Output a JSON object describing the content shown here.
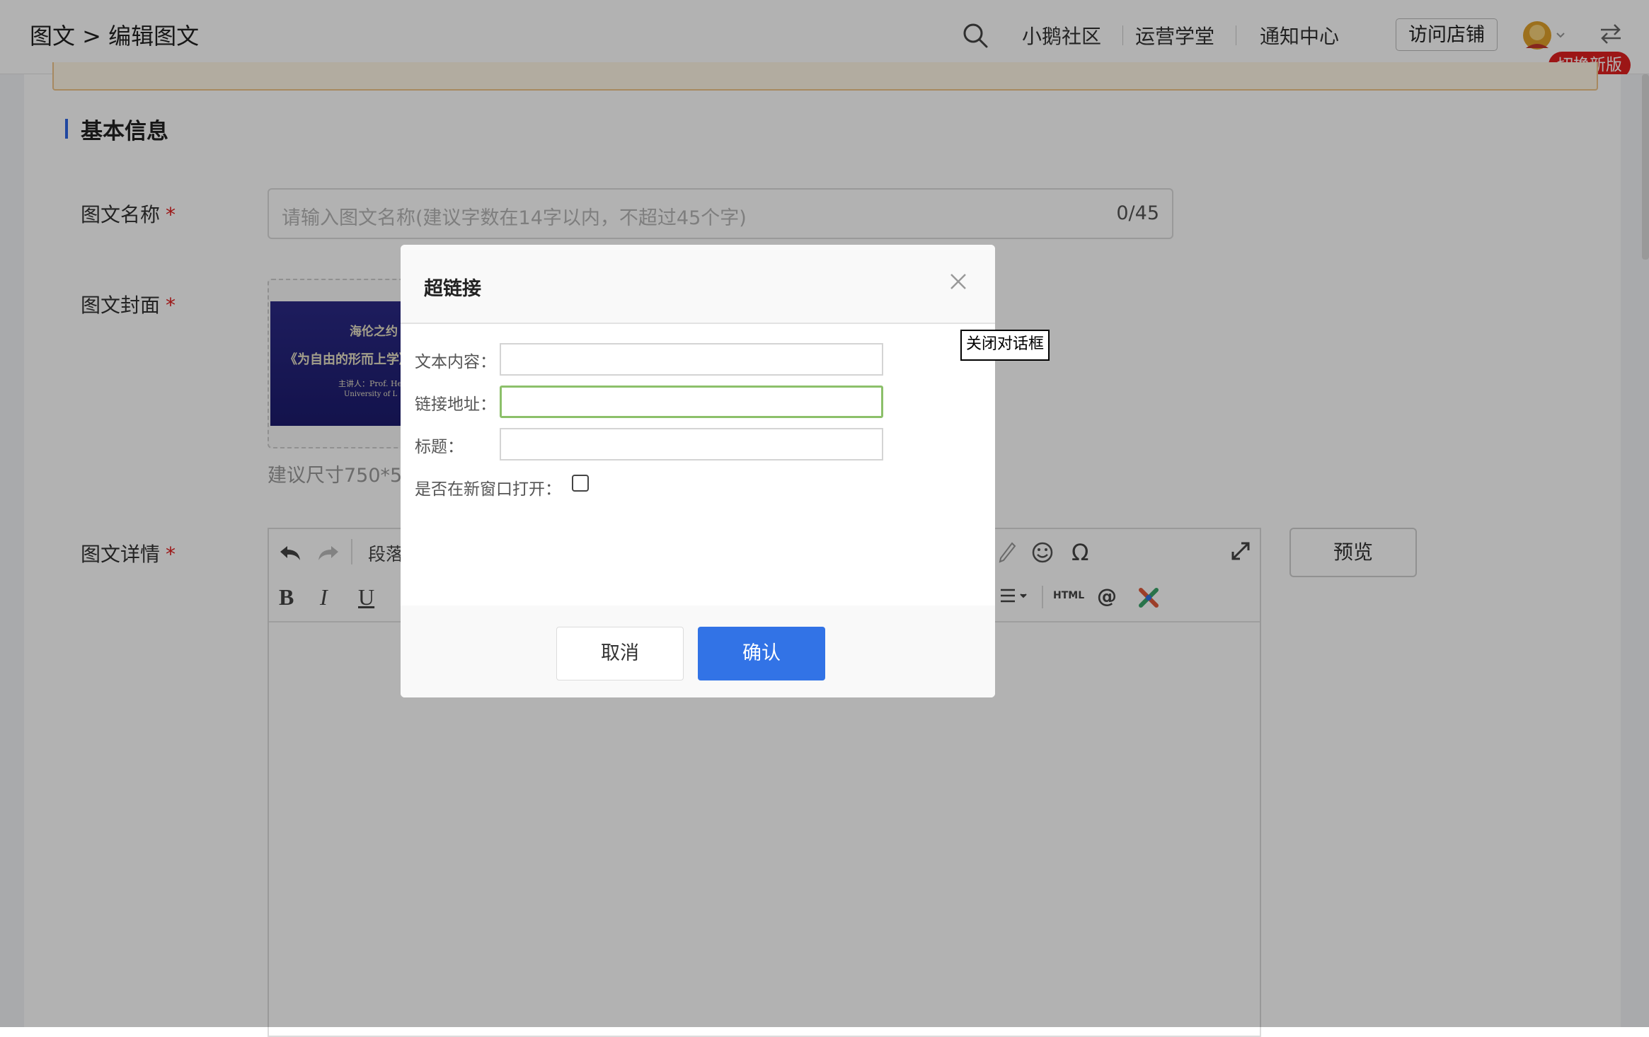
{
  "header": {
    "breadcrumb": "图文 > 编辑图文",
    "nav": [
      "小鹅社区",
      "运营学堂",
      "通知中心"
    ],
    "visit_store": "访问店铺",
    "switch_new_version": "切换新版"
  },
  "section": {
    "title": "基本信息"
  },
  "form": {
    "name_label": "图文名称",
    "required_mark": "*",
    "name_placeholder": "请输入图文名称(建议字数在14字以内，不超过45个字)",
    "name_count": "0/45",
    "cover_label": "图文封面",
    "cover_text": {
      "line1": "海伦之约",
      "line2": "《为自由的形而上学》",
      "line3": "主讲人：Prof. Helen S",
      "line4": "University of L"
    },
    "cover_hint": "建议尺寸750*5",
    "detail_label": "图文详情",
    "paragraph_label": "段落",
    "html_label": "HTML",
    "preview": "预览"
  },
  "modal": {
    "title": "超链接",
    "text_label": "文本内容：",
    "text_value": "",
    "url_label": "链接地址：",
    "url_value": "",
    "title_label": "标题：",
    "title_value": "",
    "new_window_label": "是否在新窗口打开：",
    "new_window_checked": false,
    "cancel": "取消",
    "confirm": "确认",
    "close_tooltip": "关闭对话框"
  },
  "colors": {
    "primary": "#3273e6",
    "required": "#e02020",
    "focus_border": "#8cc06a",
    "badge": "#e02020"
  }
}
